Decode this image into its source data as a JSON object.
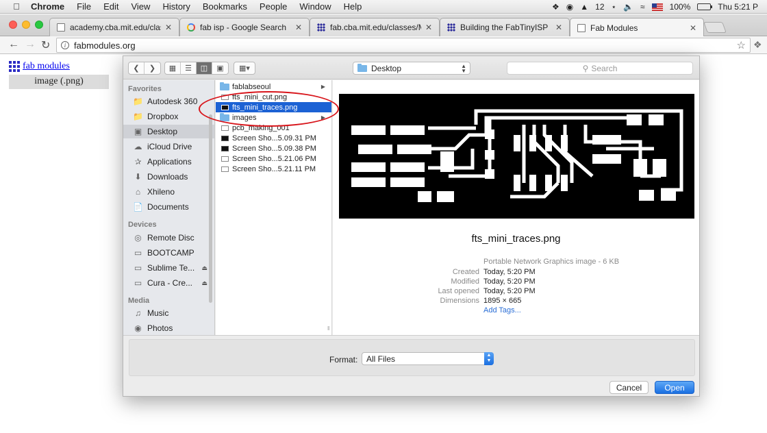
{
  "menubar": {
    "app": "Chrome",
    "items": [
      "File",
      "Edit",
      "View",
      "History",
      "Bookmarks",
      "People",
      "Window",
      "Help"
    ],
    "tray_count": "12",
    "battery": "100%",
    "clock": "Thu 5:21 P"
  },
  "tabs": [
    {
      "title": "academy.cba.mit.edu/classes/"
    },
    {
      "title": "fab isp - Google Search"
    },
    {
      "title": "fab.cba.mit.edu/classes/MAS"
    },
    {
      "title": "Building the FabTinyISP"
    },
    {
      "title": "Fab Modules"
    }
  ],
  "toolbar": {
    "url": "fabmodules.org"
  },
  "page": {
    "link": "fab modules",
    "menu_item": "image (.png)"
  },
  "dialog": {
    "location": "Desktop",
    "search_placeholder": "Search",
    "sidebar": {
      "favorites_heading": "Favorites",
      "favorites": [
        {
          "label": "Autodesk 360",
          "icon": "folder-icon"
        },
        {
          "label": "Dropbox",
          "icon": "dropbox-icon"
        },
        {
          "label": "Desktop",
          "icon": "desktop-icon"
        },
        {
          "label": "iCloud Drive",
          "icon": "cloud-icon"
        },
        {
          "label": "Applications",
          "icon": "applications-icon"
        },
        {
          "label": "Downloads",
          "icon": "downloads-icon"
        },
        {
          "label": "Xhileno",
          "icon": "home-icon"
        },
        {
          "label": "Documents",
          "icon": "documents-icon"
        }
      ],
      "devices_heading": "Devices",
      "devices": [
        {
          "label": "Remote Disc",
          "icon": "disc-icon"
        },
        {
          "label": "BOOTCAMP",
          "icon": "drive-icon"
        },
        {
          "label": "Sublime Te...",
          "icon": "drive-icon"
        },
        {
          "label": "Cura - Cre...",
          "icon": "drive-icon"
        }
      ],
      "media_heading": "Media",
      "media": [
        {
          "label": "Music",
          "icon": "music-icon"
        },
        {
          "label": "Photos",
          "icon": "camera-icon"
        }
      ]
    },
    "files": [
      {
        "name": "fablabseoul",
        "kind": "folder"
      },
      {
        "name": "fts_mini_cut.png",
        "kind": "image"
      },
      {
        "name": "fts_mini_traces.png",
        "kind": "image"
      },
      {
        "name": "images",
        "kind": "folder"
      },
      {
        "name": "pcb_making_001",
        "kind": "image"
      },
      {
        "name": "Screen Sho...5.09.31 PM",
        "kind": "screenshot"
      },
      {
        "name": "Screen Sho...5.09.38 PM",
        "kind": "screenshot"
      },
      {
        "name": "Screen Sho...5.21.06 PM",
        "kind": "screenshot"
      },
      {
        "name": "Screen Sho...5.21.11 PM",
        "kind": "screenshot"
      }
    ],
    "selected_file": "fts_mini_traces.png",
    "preview": {
      "name": "fts_mini_traces.png",
      "kind": "Portable Network Graphics image - 6 KB",
      "created_label": "Created",
      "created": "Today, 5:20 PM",
      "modified_label": "Modified",
      "modified": "Today, 5:20 PM",
      "opened_label": "Last opened",
      "opened": "Today, 5:20 PM",
      "dimensions_label": "Dimensions",
      "dimensions": "1895 × 665",
      "add_tags": "Add Tags..."
    },
    "format_label": "Format:",
    "format_value": "All Files",
    "cancel": "Cancel",
    "open": "Open"
  },
  "colors": {
    "accent": "#1c62d4",
    "annotation": "#d8151b",
    "link": "#0000ee"
  }
}
